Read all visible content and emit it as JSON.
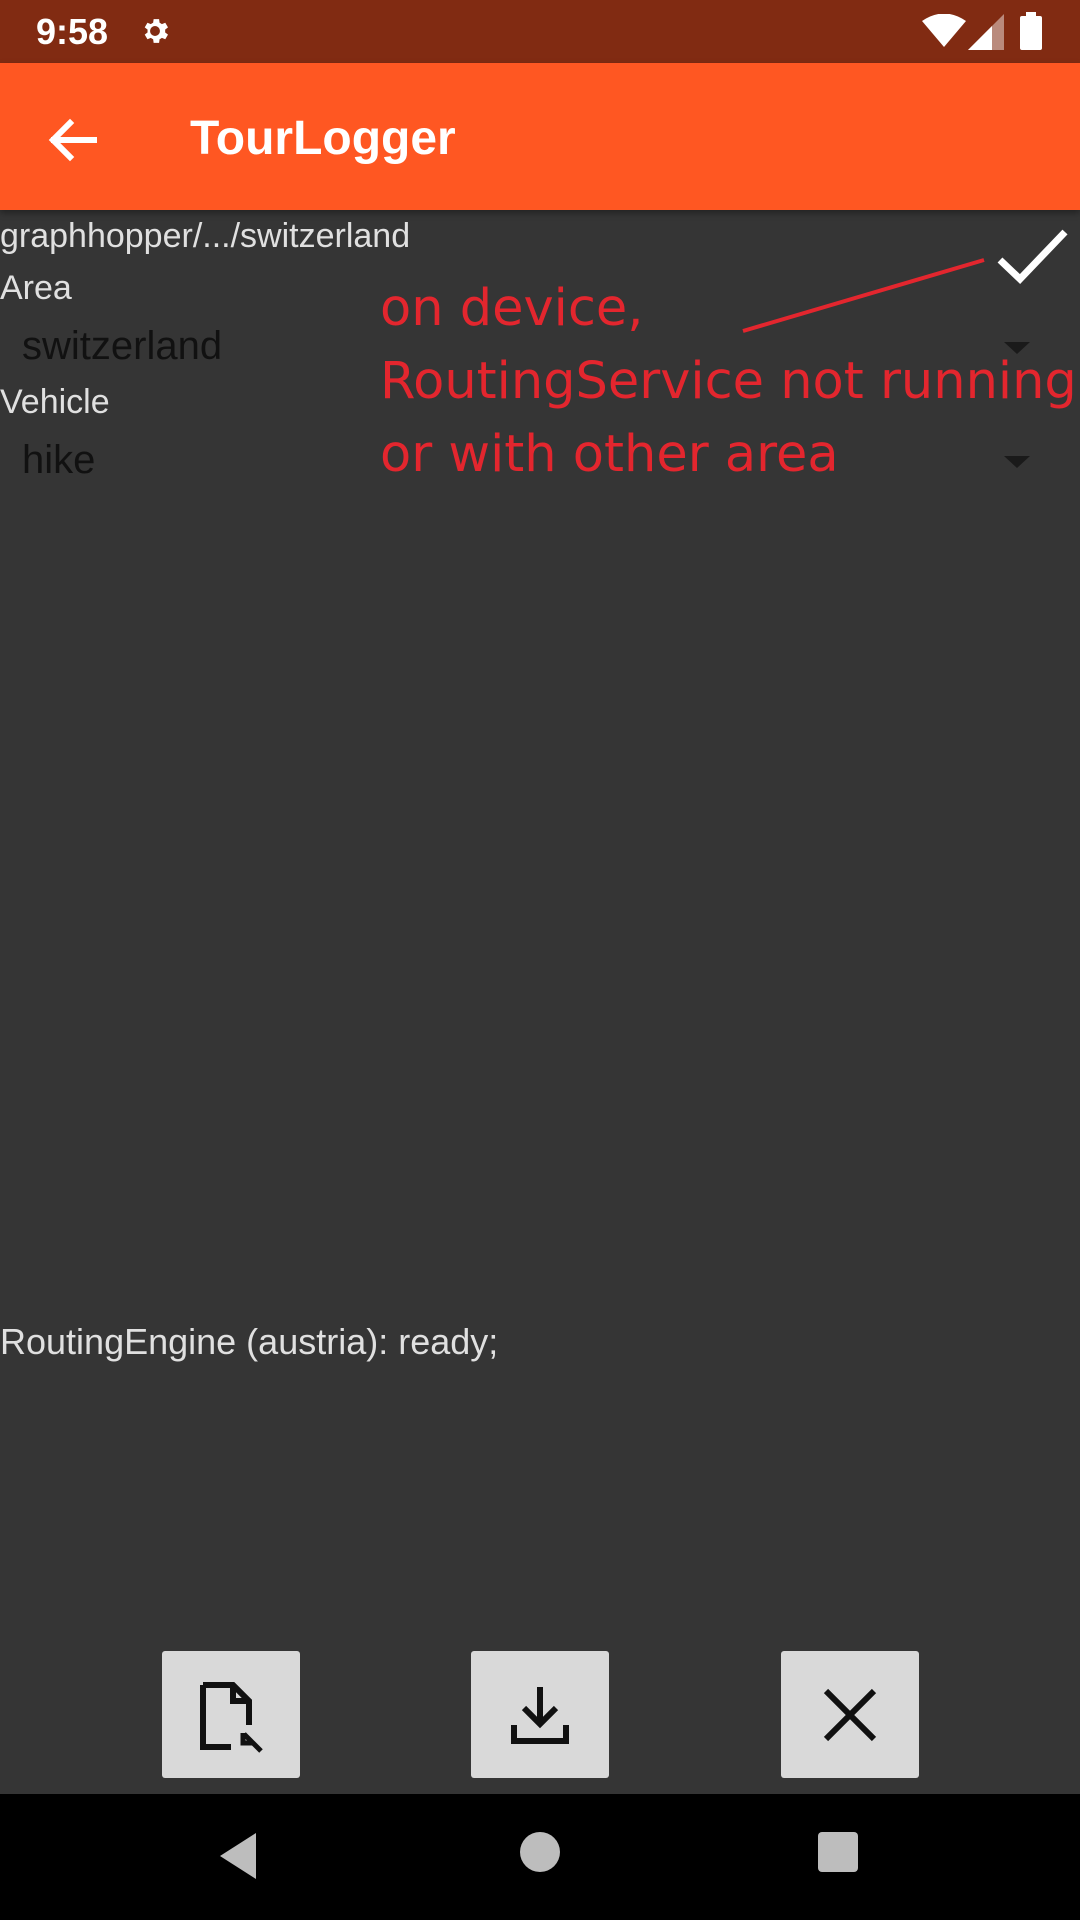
{
  "status_bar": {
    "time": "9:58",
    "icons": [
      "settings-gear-icon",
      "wifi-icon",
      "cell-signal-icon",
      "battery-icon"
    ]
  },
  "app_bar": {
    "title": "TourLogger",
    "back_icon": "arrow-left-icon",
    "background_color": "#ff5722"
  },
  "content": {
    "path": "graphhopper/.../switzerland",
    "area_label": "Area",
    "area_value": "switzerland",
    "vehicle_label": "Vehicle",
    "vehicle_value": "hike",
    "confirm_icon": "checkmark-icon",
    "engine_status": "RoutingEngine (austria): ready;"
  },
  "annotation": {
    "lines": [
      "on device,",
      "RoutingService not running",
      "or with other area"
    ],
    "color": "#e3262e"
  },
  "bottom_buttons": [
    {
      "icon": "file-select-icon"
    },
    {
      "icon": "download-icon"
    },
    {
      "icon": "close-icon"
    }
  ],
  "nav_bar": {
    "icons": [
      "nav-back-icon",
      "nav-home-icon",
      "nav-recents-icon"
    ]
  }
}
